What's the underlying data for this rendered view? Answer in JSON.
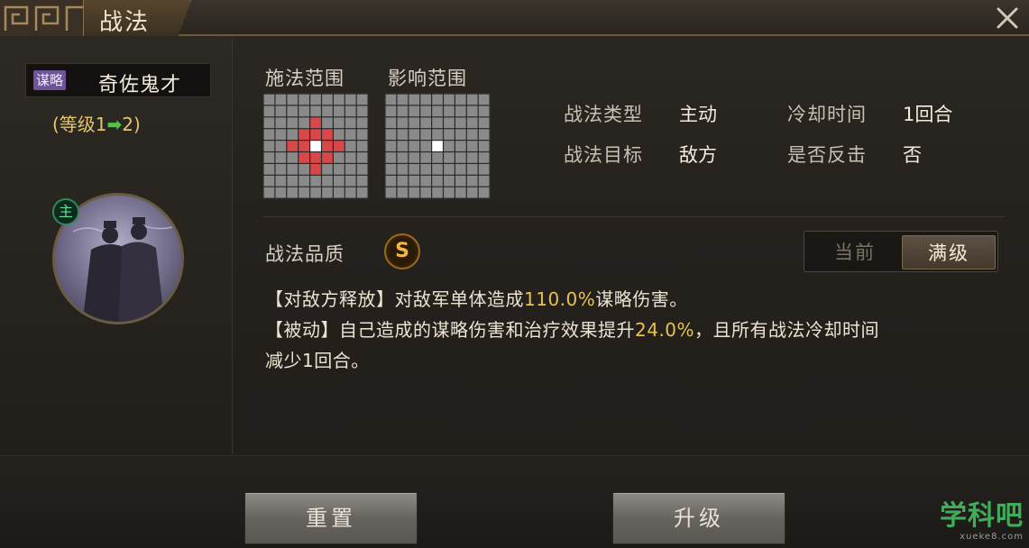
{
  "title": "战法",
  "skill": {
    "type_tag": "谋略",
    "name": "奇佐鬼才",
    "level_prefix": "(等级1",
    "level_arrow": "➡",
    "level_suffix": "2)",
    "commander_badge": "主"
  },
  "ranges": {
    "cast_label": "施法范围",
    "effect_label": "影响范围"
  },
  "info": {
    "type_label": "战法类型",
    "type_value": "主动",
    "cooldown_label": "冷却时间",
    "cooldown_value": "1回合",
    "target_label": "战法目标",
    "target_value": "敌方",
    "counter_label": "是否反击",
    "counter_value": "否"
  },
  "quality": {
    "label": "战法品质",
    "grade": "S"
  },
  "toggle": {
    "current": "当前",
    "max": "满级"
  },
  "description": {
    "line1_a": "【对敌方释放】对敌军单体造成",
    "line1_hl": "110.0%",
    "line1_b": "谋略伤害。",
    "line2_a": "【被动】自己造成的谋略伤害和治疗效果提升",
    "line2_hl": "24.0%",
    "line2_b": "，且所有战法冷却时间",
    "line3": "减少1回合。"
  },
  "buttons": {
    "reset": "重置",
    "upgrade": "升级"
  },
  "watermark": {
    "main": "学科吧",
    "sub": "xueke8.com"
  },
  "colors": {
    "highlight": "#e7c24c",
    "range_red": "#d8484a",
    "grid_cell": "#8a8a8a",
    "level_text": "#e6c66a",
    "arrow_green": "#58c447"
  },
  "icons": {
    "close": "close-x-icon",
    "ornament": "meander-ornament-icon"
  }
}
